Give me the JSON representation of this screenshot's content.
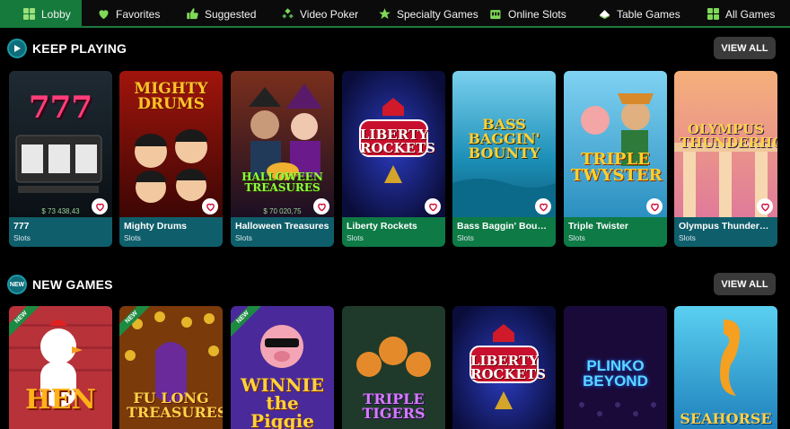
{
  "nav": {
    "items": [
      {
        "label": "Lobby",
        "icon": "grid-icon",
        "active": true
      },
      {
        "label": "Favorites",
        "icon": "heart-icon",
        "active": false
      },
      {
        "label": "Suggested",
        "icon": "thumbs-up-icon",
        "active": false
      },
      {
        "label": "Video Poker",
        "icon": "cards-icon",
        "active": false
      },
      {
        "label": "Specialty Games",
        "icon": "star-icon",
        "active": false
      },
      {
        "label": "Online Slots",
        "icon": "slot-machine-icon",
        "active": false
      },
      {
        "label": "Table Games",
        "icon": "chip-icon",
        "active": false
      },
      {
        "label": "All Games",
        "icon": "grid-icon",
        "active": false
      }
    ]
  },
  "colors": {
    "accent": "#157a3b",
    "caption_teal": "#0f5e6b",
    "caption_green": "#0e7a45"
  },
  "keep_playing": {
    "title": "KEEP PLAYING",
    "icon": "play-icon",
    "view_all": "VIEW ALL",
    "tiles": [
      {
        "name": "777",
        "category": "Slots",
        "art_title": "777",
        "jackpot": "$ 73 438,43"
      },
      {
        "name": "Mighty Drums",
        "category": "Slots",
        "art_title": "MIGHTY DRUMS",
        "jackpot": ""
      },
      {
        "name": "Halloween Treasures",
        "category": "Slots",
        "art_title": "HALLOWEEN TREASURES",
        "jackpot": "$ 70 020,75"
      },
      {
        "name": "Liberty Rockets",
        "category": "Slots",
        "art_title": "LIBERTY ROCKETS",
        "jackpot": ""
      },
      {
        "name": "Bass Baggin' Bounty",
        "category": "Slots",
        "art_title": "BASS BAGGIN' BOUNTY",
        "jackpot": ""
      },
      {
        "name": "Triple Twister",
        "category": "Slots",
        "art_title": "TRIPLE TWYSTER",
        "jackpot": ""
      },
      {
        "name": "Olympus Thunderhold",
        "category": "Slots",
        "art_title": "OLYMPUS THUNDERHOLD",
        "jackpot": ""
      }
    ]
  },
  "new_games": {
    "title": "NEW GAMES",
    "badge": "NEW",
    "view_all": "VIEW ALL",
    "tiles": [
      {
        "art_title": "HEN",
        "ribbon": "NEW"
      },
      {
        "art_title": "FU LONG TREASURES",
        "ribbon": "NEW"
      },
      {
        "art_title": "WINNIE the Piggie",
        "ribbon": "NEW"
      },
      {
        "art_title": "TRIPLE TIGERS",
        "ribbon": ""
      },
      {
        "art_title": "LIBERTY ROCKETS",
        "ribbon": ""
      },
      {
        "art_title": "PLINKO BEYOND",
        "ribbon": ""
      },
      {
        "art_title": "SEAHORSE",
        "ribbon": ""
      }
    ]
  }
}
